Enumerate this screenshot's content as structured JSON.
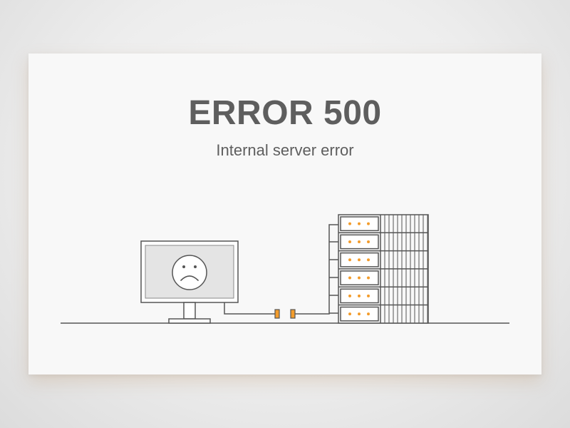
{
  "error": {
    "title": "ERROR 500",
    "message": "Internal server error"
  },
  "illustration": {
    "monitor_icon": "sad-face-icon",
    "server_icon": "server-rack-icon",
    "cable_icon": "disconnected-plug-icon"
  },
  "colors": {
    "text": "#5e5e5e",
    "line": "#555555",
    "accent": "#f39c2b",
    "screen": "#e4e4e4",
    "card": "#f8f8f8"
  }
}
